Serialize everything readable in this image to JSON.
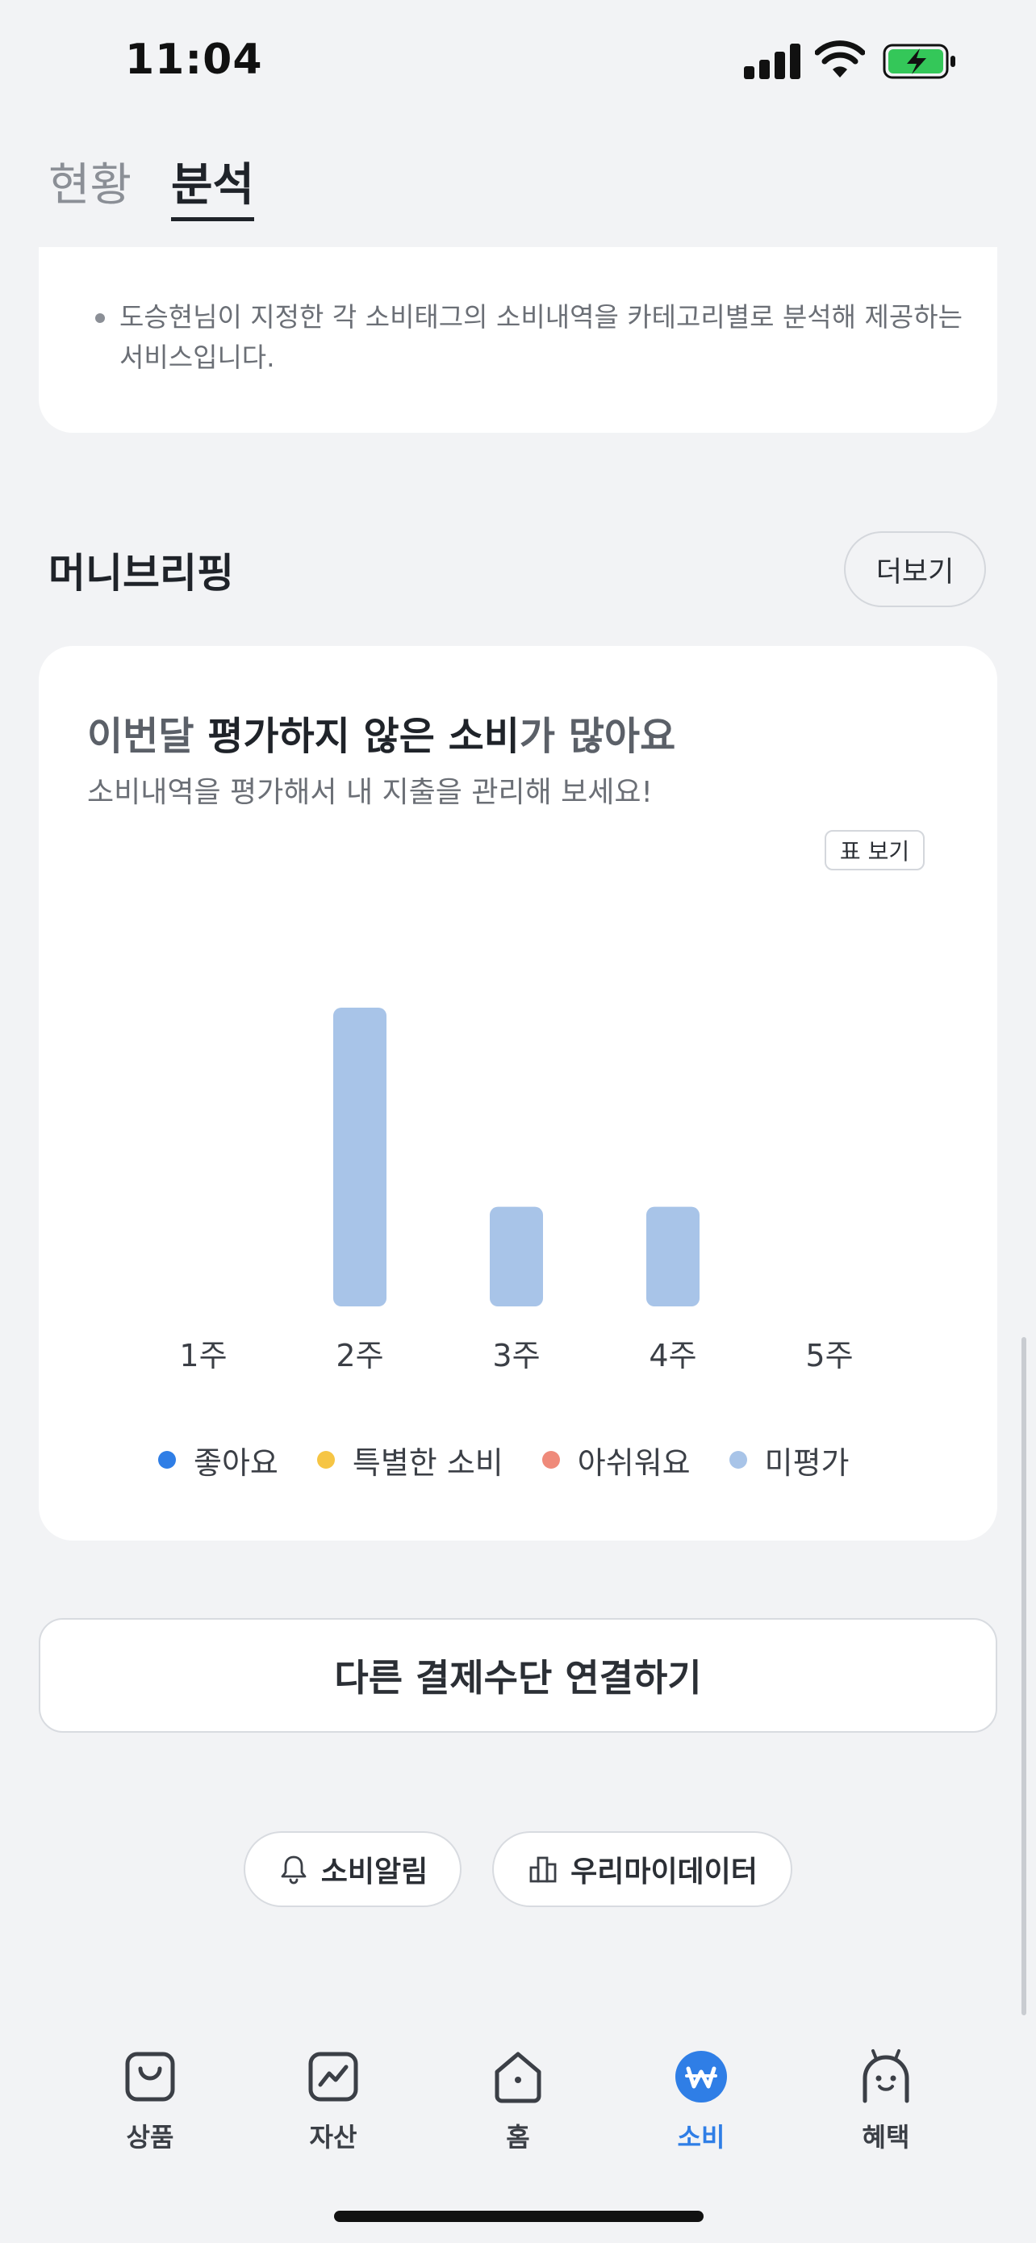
{
  "status_bar": {
    "time": "11:04"
  },
  "top_tabs": [
    {
      "label": "현황"
    },
    {
      "label": "분석"
    }
  ],
  "analysis_note": "도승현님이 지정한 각 소비태그의 소비내역을 카테고리별로 분석해 제공하는 서비스입니다.",
  "money_briefing": {
    "title": "머니브리핑",
    "more_label": "더보기",
    "headline": {
      "part1": "이번달 ",
      "part2": "평가하지 않은 소비",
      "part3": "가 많아요"
    },
    "subtext": "소비내역을 평가해서 내 지출을 관리해 보세요!",
    "table_view_label": "표 보기"
  },
  "chart_data": {
    "type": "bar",
    "categories": [
      "1주",
      "2주",
      "3주",
      "4주",
      "5주"
    ],
    "series": [
      {
        "name": "좋아요",
        "color": "#2f7ee6",
        "values": [
          0,
          0,
          0,
          0,
          0
        ]
      },
      {
        "name": "특별한 소비",
        "color": "#f6c544",
        "values": [
          0,
          0,
          0,
          0,
          0
        ]
      },
      {
        "name": "아쉬워요",
        "color": "#ef8a7a",
        "values": [
          0,
          0,
          0,
          0,
          0
        ]
      },
      {
        "name": "미평가",
        "color": "#a8c4e8",
        "values": [
          0,
          3,
          1,
          1,
          0
        ]
      }
    ],
    "ylim": [
      0,
      3
    ],
    "grid": false,
    "legend": "bottom"
  },
  "connect_button_label": "다른 결제수단 연결하기",
  "pills": {
    "alert_label": "소비알림",
    "mydata_label": "우리마이데이터"
  },
  "bottom_nav": [
    {
      "label": "상품",
      "icon": "shopping-bag-icon"
    },
    {
      "label": "자산",
      "icon": "chart-line-icon"
    },
    {
      "label": "홈",
      "icon": "home-icon"
    },
    {
      "label": "소비",
      "icon": "won-icon",
      "active": true
    },
    {
      "label": "혜택",
      "icon": "character-icon"
    }
  ]
}
